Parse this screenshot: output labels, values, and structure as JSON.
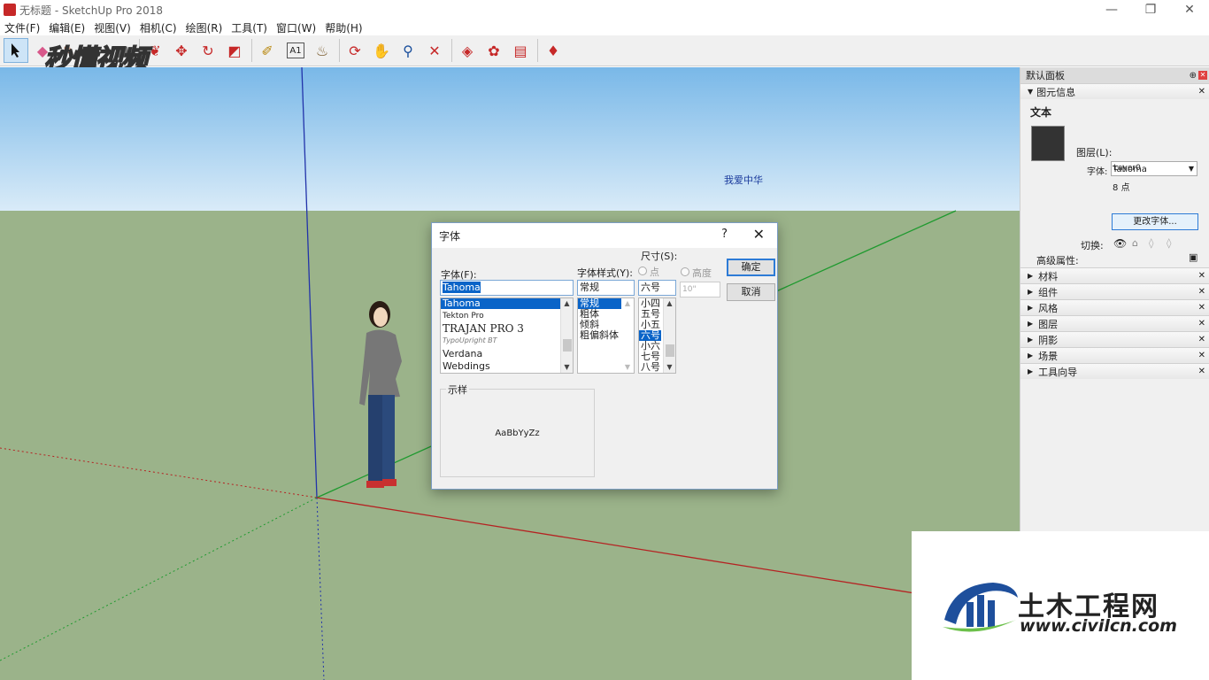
{
  "window": {
    "title": "无标题 - SketchUp Pro 2018",
    "controls": [
      "—",
      "❐",
      "✕"
    ]
  },
  "menu": [
    "文件(F)",
    "编辑(E)",
    "视图(V)",
    "相机(C)",
    "绘图(R)",
    "工具(T)",
    "窗口(W)",
    "帮助(H)"
  ],
  "toolbar": {
    "tools": [
      "select",
      "eraser",
      "paint",
      "pencil",
      "push-pull",
      "move",
      "rotate",
      "scale",
      "tape-measure",
      "text",
      "paint-bucket",
      "orbit",
      "pan",
      "zoom",
      "zoom-extents",
      "warehouse",
      "extension",
      "share",
      "ruby"
    ],
    "watermark": "秒懂视频"
  },
  "scene": {
    "text_label": "我爱中华"
  },
  "dialog": {
    "title": "字体",
    "help": "?",
    "close": "✕",
    "font_label": "字体(F):",
    "font_value": "Tahoma",
    "fonts": [
      "Tahoma",
      "Tekton Pro",
      "TRAJAN PRO 3",
      "TypoUpright BT",
      "Verdana",
      "Webdings"
    ],
    "style_label": "字体样式(Y):",
    "style_value": "常规",
    "styles": [
      "常规",
      "粗体",
      "倾斜",
      "粗偏斜体"
    ],
    "size_label": "尺寸(S):",
    "size_value": "六号",
    "sizes": [
      "小四",
      "五号",
      "小五",
      "六号",
      "小六",
      "七号",
      "八号"
    ],
    "radio_point": "点",
    "radio_height": "高度",
    "height_value": "10\"",
    "ok": "确定",
    "cancel": "取消",
    "sample_label": "示样",
    "sample_text": "AaBbYyZz"
  },
  "panel": {
    "title": "默认面板",
    "entity_info": "图元信息",
    "entity_type": "文本",
    "layer_label": "图层(L):",
    "layer_value": "Layer0",
    "font_label": "字体:",
    "font_value": "Tahoma",
    "size_value": "8 点",
    "change_font": "更改字体...",
    "toggle_label": "切换:",
    "advanced": "高级属性:",
    "trays": [
      "材料",
      "组件",
      "风格",
      "图层",
      "阴影",
      "场景",
      "工具向导"
    ]
  },
  "logo": {
    "title": "土木工程网",
    "url": "www.civilcn.com"
  },
  "colors": {
    "sky": "#79b8e8",
    "ground": "#9bb38a",
    "accent": "#0a64c8"
  }
}
